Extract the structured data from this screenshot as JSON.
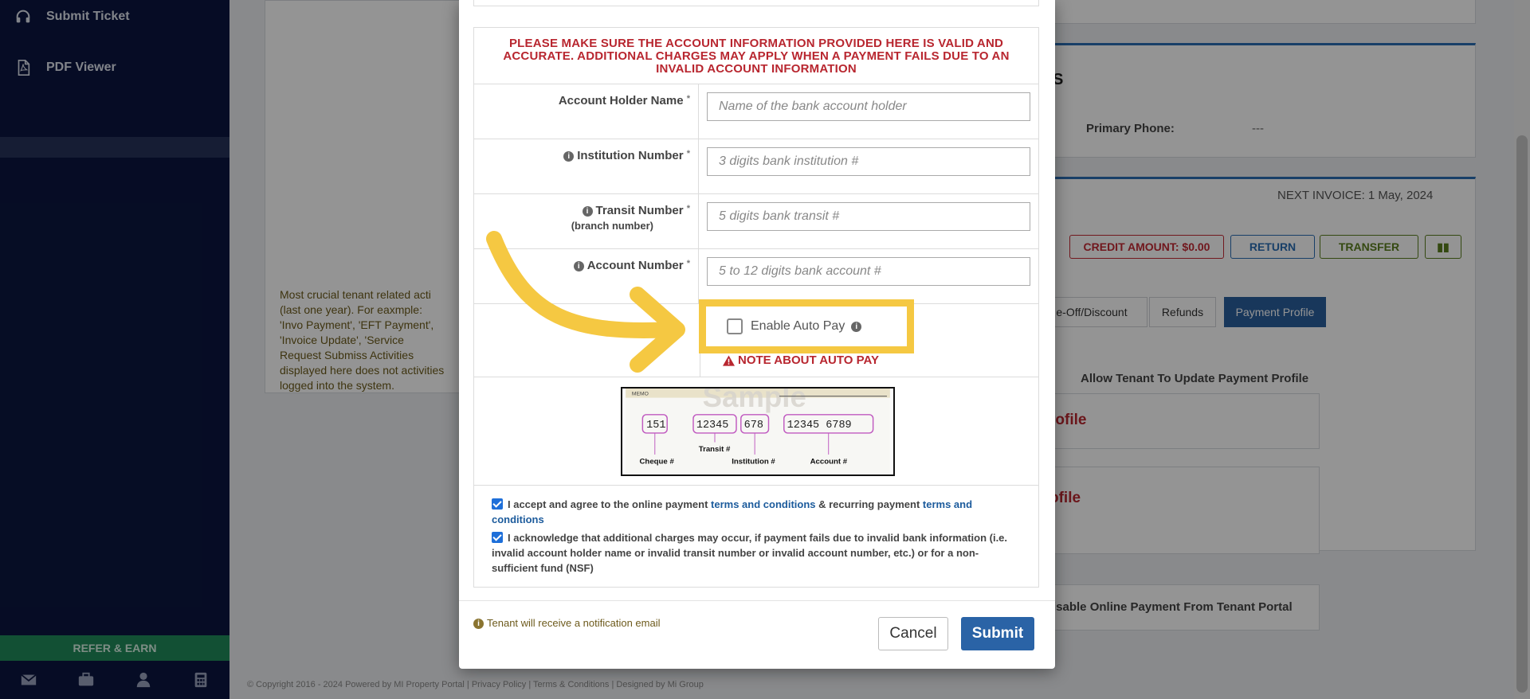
{
  "sidebar": {
    "items": [
      {
        "label": "Submit Ticket",
        "icon": "headset-icon"
      },
      {
        "label": "PDF Viewer",
        "icon": "pdf-icon"
      }
    ],
    "refer_label": "REFER & EARN"
  },
  "background": {
    "primary_phone_label": "Primary Phone:",
    "primary_phone_value": "---",
    "next_invoice": "NEXT INVOICE: 1 May, 2024",
    "credit_amount": "CREDIT AMOUNT: $0.00",
    "return_label": "RETURN",
    "transfer_label": "TRANSFER",
    "tabs": [
      "e-Off/Discount",
      "Refunds",
      "Payment Profile"
    ],
    "allow_update_label": "Allow Tenant To Update Payment Profile",
    "profile_heading_1": "rofile",
    "profile_heading_2": "ofile",
    "disable_payment_label": "isable Online Payment From Tenant Portal",
    "activity_note": "Most crucial tenant related acti (last one year). For eaxmple: 'Invo Payment', 'EFT Payment', 'Invoice Update', 'Service Request Submiss Activities displayed here does not activities logged into the system.",
    "partial_heading": "S",
    "footer": "© Copyright 2016 - 2024 Powered by MI Property Portal | Privacy Policy | Terms & Conditions | Designed by Mi Group"
  },
  "modal": {
    "warning": "PLEASE MAKE SURE THE ACCOUNT INFORMATION PROVIDED HERE IS VALID AND ACCURATE. ADDITIONAL CHARGES MAY APPLY WHEN A PAYMENT FAILS DUE TO AN INVALID ACCOUNT INFORMATION",
    "fields": {
      "holder_label": "Account Holder Name",
      "holder_placeholder": "Name of the bank account holder",
      "institution_label": "Institution Number",
      "institution_placeholder": "3 digits bank institution #",
      "transit_label": "Transit Number",
      "transit_sub": "(branch number)",
      "transit_placeholder": "5 digits bank transit #",
      "account_label": "Account Number",
      "account_placeholder": "5 to 12 digits bank account #"
    },
    "autopay_label": "Enable Auto Pay",
    "note_autopay": "NOTE ABOUT AUTO PAY",
    "cheque": {
      "memo": "MEMO",
      "sample": "Sample",
      "cheque_digits": "151",
      "transit_digits": "12345",
      "institution_digits": "678",
      "account_digits": "12345 6789",
      "transit_label": "Transit #",
      "cheque_label": "Cheque #",
      "institution_label": "Institution #",
      "account_label": "Account #"
    },
    "accept_text_1": "I accept and agree to the online payment",
    "accept_link_1": "terms and conditions",
    "accept_text_2": "& recurring payment",
    "accept_link_2": "terms and conditions",
    "acknowledge_text": "I acknowledge that additional charges may occur, if payment fails due to invalid bank information (i.e. invalid account holder name or invalid transit number or invalid account number, etc.) or for a non-sufficient fund (NSF)",
    "notification": "Tenant will receive a notification email",
    "cancel_label": "Cancel",
    "submit_label": "Submit"
  },
  "colors": {
    "sidebar_bg": "#0b1640",
    "highlight": "#f5c842",
    "warning_red": "#b8262f",
    "submit_blue": "#2a63a6"
  }
}
